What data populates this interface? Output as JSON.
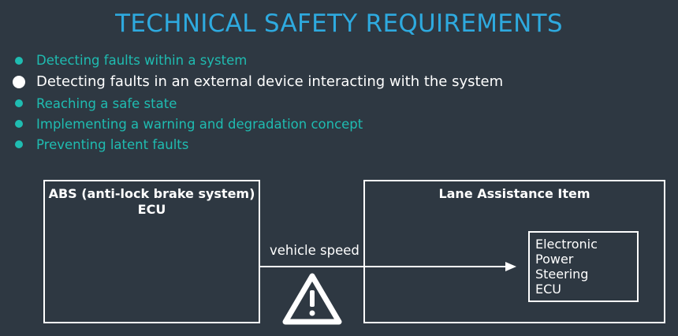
{
  "title": "TECHNICAL SAFETY REQUIREMENTS",
  "bullets": [
    {
      "text": "Detecting faults within a system",
      "highlighted": false
    },
    {
      "text": "Detecting faults in an external device interacting with the system",
      "highlighted": true
    },
    {
      "text": "Reaching a safe state",
      "highlighted": false
    },
    {
      "text": "Implementing a warning and degradation concept",
      "highlighted": false
    },
    {
      "text": "Preventing latent faults",
      "highlighted": false
    }
  ],
  "diagram": {
    "abs_box": {
      "line1": "ABS (anti-lock brake system)",
      "line2": "ECU"
    },
    "lane_box": {
      "label": "Lane Assistance Item"
    },
    "eps_box": {
      "lines": [
        "Electronic",
        "Power",
        "Steering",
        "ECU"
      ]
    },
    "arrow_label": "vehicle speed",
    "warning_icon": "warning-triangle-icon"
  },
  "colors": {
    "background": "#2e3842",
    "title": "#2eaadf",
    "bullet_teal": "#1fbcb1",
    "highlight": "#ffffff"
  }
}
